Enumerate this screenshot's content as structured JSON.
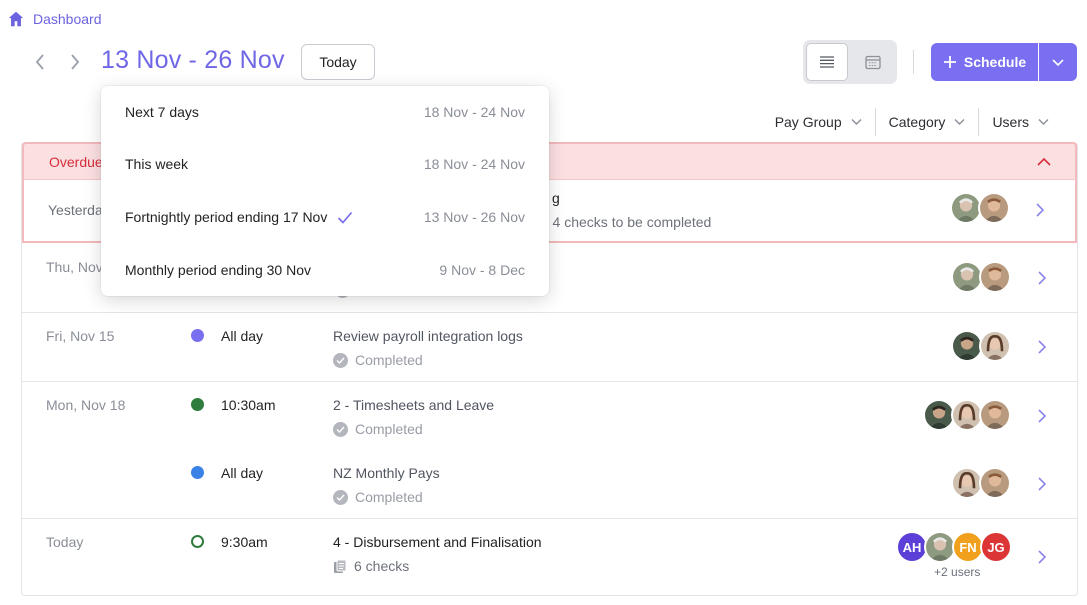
{
  "breadcrumb": {
    "label": "Dashboard",
    "icon": "home-icon"
  },
  "header": {
    "range_title": "13 Nov - 26 Nov",
    "today_label": "Today",
    "schedule_label": "Schedule",
    "active_view": "list"
  },
  "filters": [
    {
      "label": "Pay Group"
    },
    {
      "label": "Category"
    },
    {
      "label": "Users"
    }
  ],
  "dropdown": {
    "items": [
      {
        "label": "Next 7 days",
        "range": "18 Nov - 24 Nov",
        "selected": false
      },
      {
        "label": "This week",
        "range": "18 Nov - 24 Nov",
        "selected": false
      },
      {
        "label": "Fortnightly period ending 17 Nov",
        "range": "13 Nov - 26 Nov",
        "selected": true
      },
      {
        "label": "Monthly period ending 30 Nov",
        "range": "9 Nov - 8 Dec",
        "selected": false
      }
    ]
  },
  "overdue": {
    "label": "Overdue",
    "row": {
      "date": "Yesterday",
      "task_suffix": "g",
      "status": "- 4 checks to be completed"
    }
  },
  "rows": [
    {
      "date": "Thu, Nov 14",
      "dot_color": "#7a6ff0"
    },
    {
      "date": "Fri, Nov 15",
      "time": "All day",
      "task": "Review payroll integration logs",
      "status": "Completed",
      "dot_color": "#7a6ff0"
    },
    {
      "date": "Mon, Nov 18",
      "time": "10:30am",
      "task": "2 - Timesheets and Leave",
      "status": "Completed",
      "dot_color": "#2e7d3e"
    },
    {
      "date": "",
      "time": "All day",
      "task": "NZ Monthly Pays",
      "status": "Completed",
      "dot_color": "#3b82e8"
    },
    {
      "date": "Today",
      "time": "9:30am",
      "task": "4 - Disbursement and Finalisation",
      "status": "6 checks",
      "dot_color": "#2e7d3e",
      "more_users": "+2 users"
    }
  ],
  "avatar_initials": {
    "ah": "AH",
    "fn": "FN",
    "jg": "JG"
  },
  "colors": {
    "accent": "#7a6ff0",
    "overdue": "#d62d3b",
    "ah": "#5b3fd6",
    "fn": "#f0a01c",
    "jg": "#dc3535"
  }
}
